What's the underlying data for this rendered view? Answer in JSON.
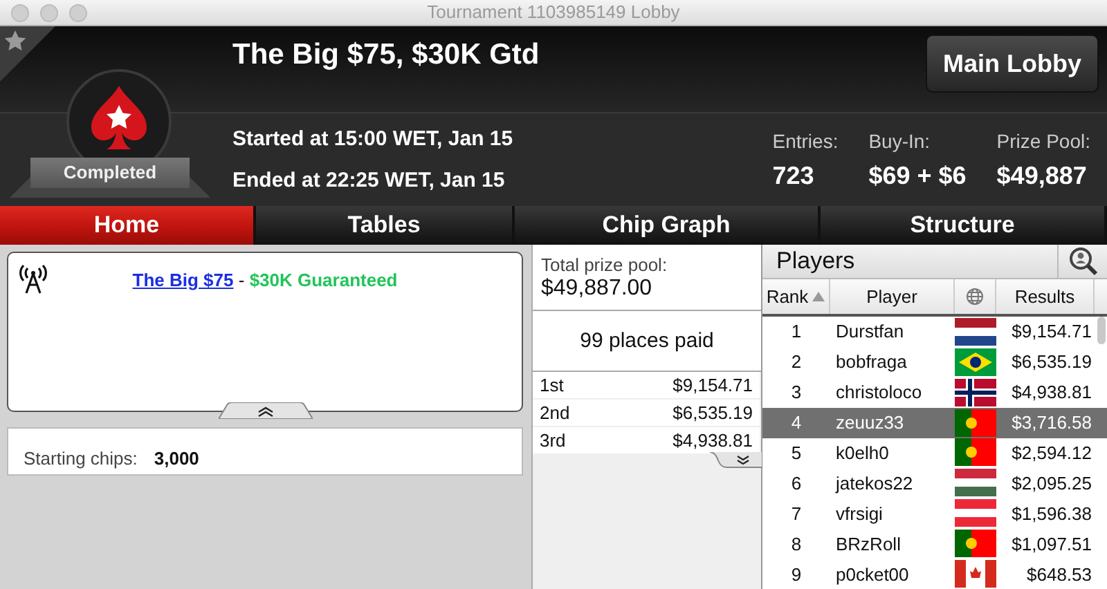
{
  "window": {
    "title": "Tournament 1103985149 Lobby"
  },
  "header": {
    "title": "The Big $75, $30K Gtd",
    "status": "Completed",
    "started": "Started at 15:00 WET, Jan 15",
    "ended": "Ended at 22:25 WET, Jan 15",
    "main_lobby_button": "Main Lobby",
    "stats": [
      {
        "label": "Entries:",
        "value": "723"
      },
      {
        "label": "Buy-In:",
        "value": "$69 + $6"
      },
      {
        "label": "Prize Pool:",
        "value": "$49,887"
      }
    ]
  },
  "tabs": [
    {
      "label": "Home",
      "selected": true
    },
    {
      "label": "Tables",
      "selected": false
    },
    {
      "label": "Chip Graph",
      "selected": false
    },
    {
      "label": "Structure",
      "selected": false
    }
  ],
  "info": {
    "link": "The Big $75",
    "separator": "-",
    "guarantee": "$30K Guaranteed",
    "starting_chips_label": "Starting chips:",
    "starting_chips": "3,000"
  },
  "prizes": {
    "total_label": "Total prize pool:",
    "total": "$49,887.00",
    "places_paid": "99 places paid",
    "rows": [
      {
        "place": "1st",
        "amount": "$9,154.71"
      },
      {
        "place": "2nd",
        "amount": "$6,535.19"
      },
      {
        "place": "3rd",
        "amount": "$4,938.81"
      }
    ]
  },
  "players": {
    "title": "Players",
    "columns": [
      "Rank",
      "Player",
      "Results"
    ],
    "rows": [
      {
        "rank": "1",
        "name": "Durstfan",
        "kind": "nl",
        "result": "$9,154.71",
        "selected": false
      },
      {
        "rank": "2",
        "name": "bobfraga",
        "kind": "br",
        "result": "$6,535.19",
        "selected": false
      },
      {
        "rank": "3",
        "name": "christoloco",
        "kind": "no",
        "result": "$4,938.81",
        "selected": false
      },
      {
        "rank": "4",
        "name": "zeuuz33",
        "kind": "pt",
        "result": "$3,716.58",
        "selected": true
      },
      {
        "rank": "5",
        "name": "k0elh0",
        "kind": "pt",
        "result": "$2,594.12",
        "selected": false
      },
      {
        "rank": "6",
        "name": "jatekos22",
        "kind": "hu",
        "result": "$2,095.25",
        "selected": false
      },
      {
        "rank": "7",
        "name": "vfrsigi",
        "kind": "at",
        "result": "$1,596.38",
        "selected": false
      },
      {
        "rank": "8",
        "name": "BRzRoll",
        "kind": "pt",
        "result": "$1,097.51",
        "selected": false
      },
      {
        "rank": "9",
        "name": "p0cket00",
        "kind": "ca",
        "result": "$648.53",
        "selected": false
      }
    ]
  }
}
